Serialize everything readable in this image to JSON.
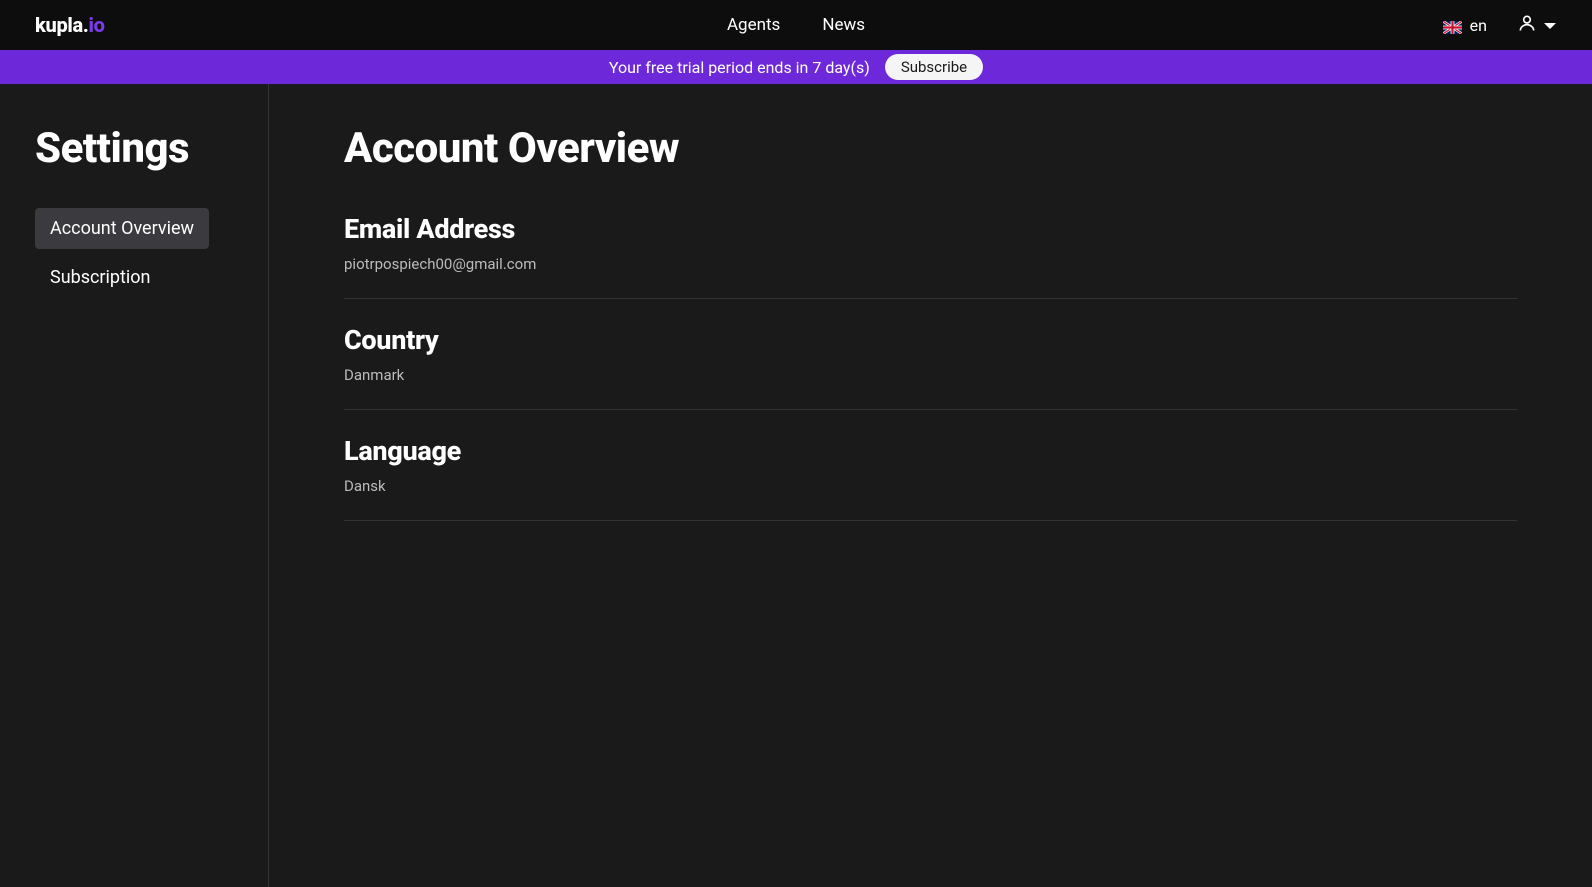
{
  "header": {
    "logo": {
      "main": "kupla",
      "dot": ".",
      "ext": "io"
    },
    "nav": [
      {
        "label": "Agents"
      },
      {
        "label": "News"
      }
    ],
    "language": "en",
    "flag": "gb"
  },
  "banner": {
    "message": "Your free trial period ends in 7 day(s)",
    "button_label": "Subscribe"
  },
  "sidebar": {
    "title": "Settings",
    "items": [
      {
        "label": "Account Overview",
        "active": true
      },
      {
        "label": "Subscription",
        "active": false
      }
    ]
  },
  "main": {
    "title": "Account Overview",
    "sections": [
      {
        "title": "Email Address",
        "value": "piotrpospiech00@gmail.com"
      },
      {
        "title": "Country",
        "value": "Danmark"
      },
      {
        "title": "Language",
        "value": "Dansk"
      }
    ]
  }
}
